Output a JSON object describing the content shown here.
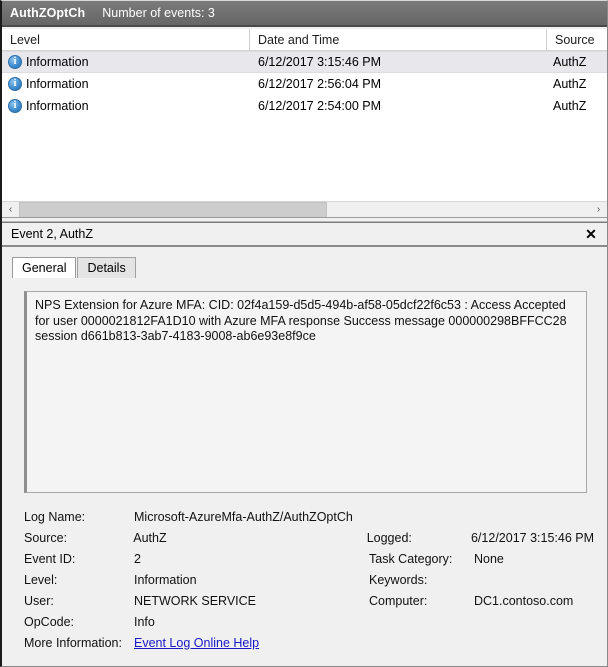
{
  "header": {
    "log_name": "AuthZOptCh",
    "event_count_label": "Number of events: 3"
  },
  "event_list": {
    "columns": [
      "Level",
      "Date and Time",
      "Source"
    ],
    "rows": [
      {
        "icon": "information-icon",
        "level": "Information",
        "datetime": "6/12/2017 3:15:46 PM",
        "source": "AuthZ",
        "selected": true
      },
      {
        "icon": "information-icon",
        "level": "Information",
        "datetime": "6/12/2017 2:56:04 PM",
        "source": "AuthZ",
        "selected": false
      },
      {
        "icon": "information-icon",
        "level": "Information",
        "datetime": "6/12/2017 2:54:00 PM",
        "source": "AuthZ",
        "selected": false
      }
    ],
    "scrollbar": {
      "left_arrow": "‹",
      "right_arrow": "›"
    }
  },
  "detail_panel": {
    "title": "Event 2, AuthZ",
    "close_label": "✕",
    "tabs": [
      {
        "label": "General",
        "active": true
      },
      {
        "label": "Details",
        "active": false
      }
    ],
    "description": "NPS Extension for Azure MFA:  CID: 02f4a159-d5d5-494b-af58-05dcf22f6c53 : Access Accepted for user 0000021812FA1D10 with Azure MFA response Success message 000000298BFFCC28 session d661b813-3ab7-4183-9008-ab6e93e8f9ce",
    "fields": {
      "log_name_label": "Log Name:",
      "log_name_value": "Microsoft-AzureMfa-AuthZ/AuthZOptCh",
      "source_label": "Source:",
      "source_value": "AuthZ",
      "logged_label": "Logged:",
      "logged_value": "6/12/2017 3:15:46 PM",
      "event_id_label": "Event ID:",
      "event_id_value": "2",
      "task_category_label": "Task Category:",
      "task_category_value": "None",
      "level_label": "Level:",
      "level_value": "Information",
      "keywords_label": "Keywords:",
      "keywords_value": "",
      "user_label": "User:",
      "user_value": "NETWORK SERVICE",
      "computer_label": "Computer:",
      "computer_value": "DC1.contoso.com",
      "opcode_label": "OpCode:",
      "opcode_value": "Info",
      "more_info_label": "More Information:",
      "more_info_link": "Event Log Online Help"
    }
  },
  "colors": {
    "title_bar": "#6f6f6f",
    "info_icon": "#3f8ed0",
    "link": "#1818c8",
    "panel_bg": "#f0f0f0"
  }
}
